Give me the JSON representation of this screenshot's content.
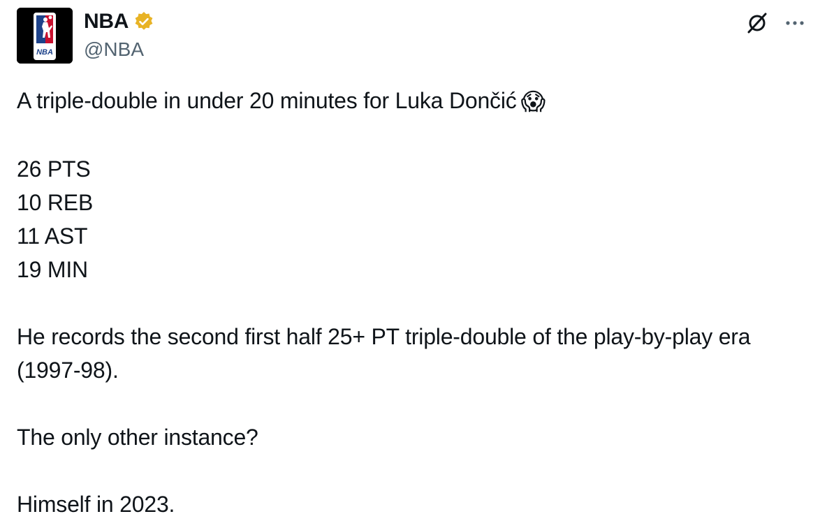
{
  "account": {
    "display_name": "NBA",
    "handle": "@NBA",
    "logo_text": "NBA",
    "verified_color": "#e8b325",
    "avatar_icon": "nba-logo-icon"
  },
  "actions": {
    "grok_icon": "grok-icon",
    "more_icon": "more-dots-icon",
    "more_label": "···"
  },
  "tweet": {
    "line1": "A triple-double in under 20 minutes for Luka Dončić",
    "line1_emoji": "😱",
    "stats": [
      "26 PTS",
      "10 REB",
      "11 AST",
      "19 MIN"
    ],
    "paragraph2": "He records the second first half 25+ PT triple-double of the play-by-play era (1997-98).",
    "paragraph3": "The only other instance?",
    "paragraph4": "Himself in 2023."
  },
  "colors": {
    "text": "#0f1419",
    "secondary_text": "#536471",
    "nba_blue": "#1d428a",
    "nba_red": "#c8102e"
  }
}
